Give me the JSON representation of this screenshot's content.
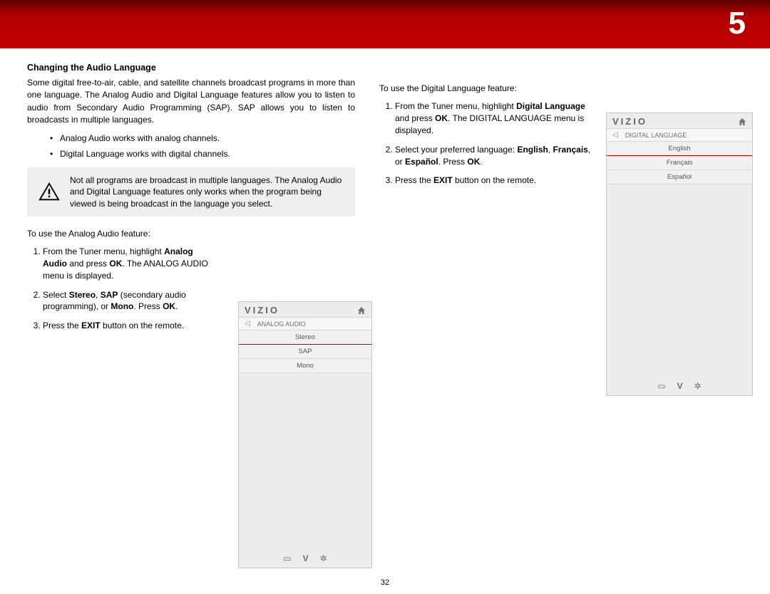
{
  "chapter_number": "5",
  "page_number": "32",
  "section": {
    "title": "Changing the Audio Language",
    "intro": "Some digital free-to-air, cable, and satellite channels broadcast programs in more than one language. The Analog Audio and Digital Language features allow you to listen to audio from Secondary Audio Programming (SAP). SAP allows you to listen to broadcasts in multiple languages.",
    "bullets": [
      "Analog Audio works with analog channels.",
      "Digital Language works with digital channels."
    ],
    "warning": "Not all programs are broadcast in multiple languages. The Analog Audio and Digital Language features only works when the program being viewed is being broadcast in the language you select."
  },
  "analog": {
    "lead": "To use the Analog Audio feature:",
    "steps": [
      {
        "pre": "From the Tuner menu, highlight ",
        "b1": "Analog Audio",
        "mid1": " and press ",
        "b2": "OK",
        "post": ". The ANALOG AUDIO menu is displayed."
      },
      {
        "pre": "Select ",
        "b1": "Stereo",
        "mid1": ", ",
        "b2": "SAP",
        "mid2": " (secondary audio programming), or ",
        "b3": "Mono",
        "post": ". Press ",
        "b4": "OK",
        "post2": "."
      },
      {
        "pre": "Press the ",
        "b1": "EXIT",
        "post": " button on the remote."
      }
    ],
    "panel": {
      "brand": "VIZIO",
      "crumb": "ANALOG AUDIO",
      "options": [
        "Stereo",
        "SAP",
        "Mono"
      ]
    }
  },
  "digital": {
    "lead": "To use the Digital Language feature:",
    "steps": [
      {
        "pre": "From the Tuner menu, highlight ",
        "b1": "Digital Language",
        "mid1": " and press ",
        "b2": "OK",
        "post": ". The DIGITAL LANGUAGE menu is displayed."
      },
      {
        "pre": "Select your preferred language: ",
        "b1": "English",
        "mid1": ", ",
        "b2": "Français",
        "mid2": ", or ",
        "b3": "Español",
        "post": ". Press ",
        "b4": "OK",
        "post2": "."
      },
      {
        "pre": "Press the ",
        "b1": "EXIT",
        "post": " button on the remote."
      }
    ],
    "panel": {
      "brand": "VIZIO",
      "crumb": "DIGITAL LANGUAGE",
      "options": [
        "English",
        "Français",
        "Español"
      ]
    }
  }
}
